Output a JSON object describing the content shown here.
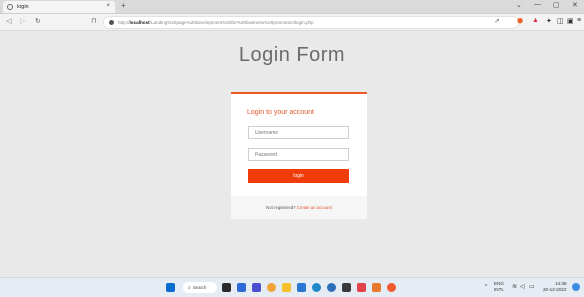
{
  "browser": {
    "tab_title": "login",
    "tab_close_glyph": "×",
    "new_tab_glyph": "+",
    "url_scheme": "http://",
    "url_host": "localhost",
    "url_path": "/Landing%20page%20development%20for%20business%20promotion/login.php",
    "window_controls": [
      "⌄",
      "—",
      "▢",
      "✕"
    ]
  },
  "page": {
    "title": "Login Form",
    "card_heading": "Login to your account",
    "username_placeholder": "Username",
    "password_placeholder": "Password",
    "login_label": "login",
    "footer_text": "Not registered? ",
    "footer_link": "Create an account"
  },
  "taskbar": {
    "search_label": "Search",
    "lang_top": "ENG",
    "lang_bottom": "INTL",
    "time": "14:38",
    "date": "20-12-2022"
  },
  "colors": {
    "accent": "#ee5a24",
    "button": "#f03c0a",
    "page_bg": "#e9e9e9"
  },
  "icons": [
    "favicon-icon",
    "back-icon",
    "forward-icon",
    "reload-icon",
    "bookmark-icon",
    "site-info-icon",
    "share-icon",
    "brave-shield-icon",
    "rewards-icon",
    "extensions-icon",
    "sidebar-icon",
    "wallet-icon",
    "menu-icon",
    "windows-start-icon",
    "search-icon",
    "taskbar-app-icons",
    "wifi-icon",
    "volume-icon",
    "battery-icon"
  ]
}
